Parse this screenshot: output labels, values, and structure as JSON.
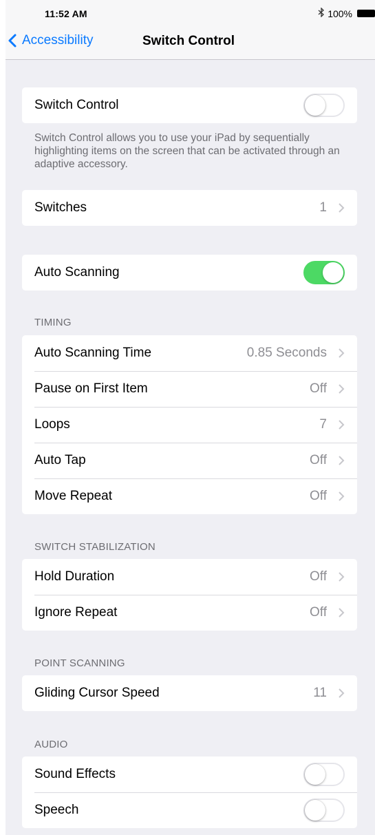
{
  "status": {
    "time": "11:52 AM",
    "battery": "100%"
  },
  "nav": {
    "back_label": "Accessibility",
    "title": "Switch Control"
  },
  "switch_control": {
    "label": "Switch Control",
    "on": false
  },
  "description": "Switch Control allows you to use your iPad by sequentially highlighting items on the screen that can be activated through an adaptive accessory.",
  "switches": {
    "label": "Switches",
    "value": "1"
  },
  "auto_scanning": {
    "label": "Auto Scanning",
    "on": true
  },
  "timing": {
    "header": "TIMING",
    "rows": [
      {
        "label": "Auto Scanning Time",
        "value": "0.85 Seconds"
      },
      {
        "label": "Pause on First Item",
        "value": "Off"
      },
      {
        "label": "Loops",
        "value": "7"
      },
      {
        "label": "Auto Tap",
        "value": "Off"
      },
      {
        "label": "Move Repeat",
        "value": "Off"
      }
    ]
  },
  "stabilization": {
    "header": "SWITCH STABILIZATION",
    "rows": [
      {
        "label": "Hold Duration",
        "value": "Off"
      },
      {
        "label": "Ignore Repeat",
        "value": "Off"
      }
    ]
  },
  "point_scanning": {
    "header": "POINT SCANNING",
    "rows": [
      {
        "label": "Gliding Cursor Speed",
        "value": "11"
      }
    ]
  },
  "audio": {
    "header": "AUDIO",
    "rows": [
      {
        "label": "Sound Effects",
        "on": false
      },
      {
        "label": "Speech",
        "on": false
      }
    ]
  },
  "colors": {
    "accent": "#0a7aff",
    "toggle_on": "#4cd964",
    "background": "#efeff4"
  }
}
